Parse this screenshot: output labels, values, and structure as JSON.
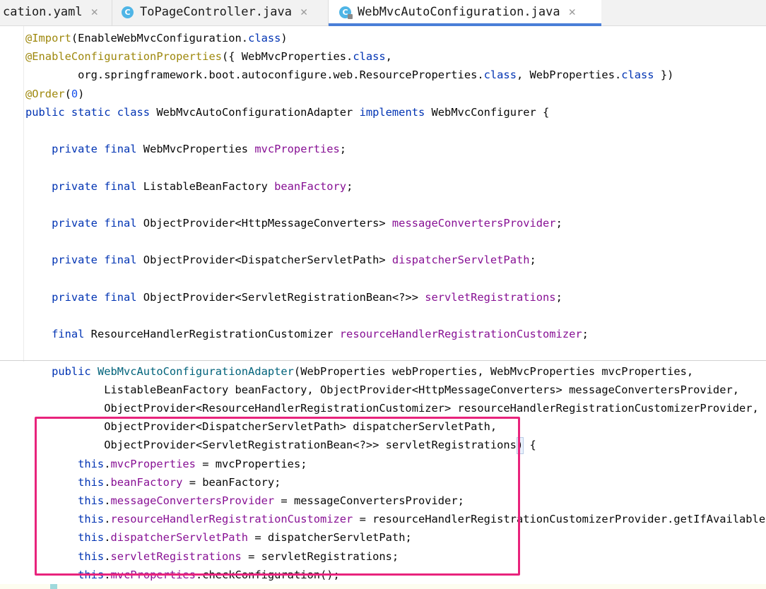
{
  "tabs": [
    {
      "label": "cation.yaml",
      "icon": null,
      "active": false
    },
    {
      "label": "ToPageController.java",
      "icon": "class-c-icon",
      "active": false
    },
    {
      "label": "WebMvcAutoConfiguration.java",
      "icon": "class-c-icon",
      "active": true
    }
  ],
  "tab_close_glyph": "✕",
  "class_icon_letter": "C",
  "colors": {
    "keyword": "#0033b3",
    "annotation": "#9e880d",
    "field": "#871094",
    "number": "#1750eb",
    "constructor": "#00627a",
    "plain": "#080808",
    "highlight_box": "#e8237c",
    "active_tab_underline": "#4a7fd8"
  },
  "code_lines": [
    [
      {
        "t": "@Import",
        "c": "anno"
      },
      {
        "t": "(EnableWebMvcConfiguration.",
        "c": "plain"
      },
      {
        "t": "class",
        "c": "kw"
      },
      {
        "t": ")",
        "c": "plain"
      }
    ],
    [
      {
        "t": "@EnableConfigurationProperties",
        "c": "anno"
      },
      {
        "t": "({ WebMvcProperties.",
        "c": "plain"
      },
      {
        "t": "class",
        "c": "kw"
      },
      {
        "t": ",",
        "c": "plain"
      }
    ],
    [
      {
        "t": "        org.springframework.boot.autoconfigure.web.ResourceProperties.",
        "c": "plain"
      },
      {
        "t": "class",
        "c": "kw"
      },
      {
        "t": ", WebProperties.",
        "c": "plain"
      },
      {
        "t": "class",
        "c": "kw"
      },
      {
        "t": " })",
        "c": "plain"
      }
    ],
    [
      {
        "t": "@Order",
        "c": "anno"
      },
      {
        "t": "(",
        "c": "plain"
      },
      {
        "t": "0",
        "c": "num"
      },
      {
        "t": ")",
        "c": "plain"
      }
    ],
    [
      {
        "t": "public static class ",
        "c": "kw"
      },
      {
        "t": "WebMvcAutoConfigurationAdapter ",
        "c": "plain"
      },
      {
        "t": "implements ",
        "c": "kw"
      },
      {
        "t": "WebMvcConfigurer {",
        "c": "plain"
      }
    ],
    [],
    [
      {
        "t": "    private final ",
        "c": "kw"
      },
      {
        "t": "WebMvcProperties ",
        "c": "plain"
      },
      {
        "t": "mvcProperties",
        "c": "field"
      },
      {
        "t": ";",
        "c": "plain"
      }
    ],
    [],
    [
      {
        "t": "    private final ",
        "c": "kw"
      },
      {
        "t": "ListableBeanFactory ",
        "c": "plain"
      },
      {
        "t": "beanFactory",
        "c": "field"
      },
      {
        "t": ";",
        "c": "plain"
      }
    ],
    [],
    [
      {
        "t": "    private final ",
        "c": "kw"
      },
      {
        "t": "ObjectProvider<HttpMessageConverters> ",
        "c": "plain"
      },
      {
        "t": "messageConvertersProvider",
        "c": "field"
      },
      {
        "t": ";",
        "c": "plain"
      }
    ],
    [],
    [
      {
        "t": "    private final ",
        "c": "kw"
      },
      {
        "t": "ObjectProvider<DispatcherServletPath> ",
        "c": "plain"
      },
      {
        "t": "dispatcherServletPath",
        "c": "field"
      },
      {
        "t": ";",
        "c": "plain"
      }
    ],
    [],
    [
      {
        "t": "    private final ",
        "c": "kw"
      },
      {
        "t": "ObjectProvider<ServletRegistrationBean<?>> ",
        "c": "plain"
      },
      {
        "t": "servletRegistrations",
        "c": "field"
      },
      {
        "t": ";",
        "c": "plain"
      }
    ],
    [],
    [
      {
        "t": "    final ",
        "c": "kw"
      },
      {
        "t": "ResourceHandlerRegistrationCustomizer ",
        "c": "plain"
      },
      {
        "t": "resourceHandlerRegistrationCustomizer",
        "c": "field"
      },
      {
        "t": ";",
        "c": "plain"
      }
    ],
    [],
    [
      {
        "t": "    public ",
        "c": "kw"
      },
      {
        "t": "WebMvcAutoConfigurationAdapter",
        "c": "ctor"
      },
      {
        "t": "(WebProperties webProperties, WebMvcProperties mvcProperties,",
        "c": "plain"
      }
    ],
    [
      {
        "t": "            ListableBeanFactory beanFactory, ObjectProvider<HttpMessageConverters> messageConvertersProvider,",
        "c": "plain"
      }
    ],
    [
      {
        "t": "            ObjectProvider<ResourceHandlerRegistrationCustomizer> resourceHandlerRegistrationCustomizerProvider,",
        "c": "plain"
      }
    ],
    [
      {
        "t": "            ObjectProvider<DispatcherServletPath> dispatcherServletPath,",
        "c": "plain"
      }
    ],
    [
      {
        "t": "            ObjectProvider<ServletRegistrationBean<?>> servletRegistrations) ",
        "c": "plain"
      },
      {
        "t": "{",
        "c": "plain"
      }
    ],
    [
      {
        "t": "        this",
        "c": "kw"
      },
      {
        "t": ".",
        "c": "plain"
      },
      {
        "t": "mvcProperties",
        "c": "field"
      },
      {
        "t": " = mvcProperties;",
        "c": "plain"
      }
    ],
    [
      {
        "t": "        this",
        "c": "kw"
      },
      {
        "t": ".",
        "c": "plain"
      },
      {
        "t": "beanFactory",
        "c": "field"
      },
      {
        "t": " = beanFactory;",
        "c": "plain"
      }
    ],
    [
      {
        "t": "        this",
        "c": "kw"
      },
      {
        "t": ".",
        "c": "plain"
      },
      {
        "t": "messageConvertersProvider",
        "c": "field"
      },
      {
        "t": " = messageConvertersProvider;",
        "c": "plain"
      }
    ],
    [
      {
        "t": "        this",
        "c": "kw"
      },
      {
        "t": ".",
        "c": "plain"
      },
      {
        "t": "resourceHandlerRegistrationCustomizer",
        "c": "field"
      },
      {
        "t": " = resourceHandlerRegistrationCustomizerProvider.getIfAvailable();",
        "c": "plain"
      }
    ],
    [
      {
        "t": "        this",
        "c": "kw"
      },
      {
        "t": ".",
        "c": "plain"
      },
      {
        "t": "dispatcherServletPath",
        "c": "field"
      },
      {
        "t": " = dispatcherServletPath;",
        "c": "plain"
      }
    ],
    [
      {
        "t": "        this",
        "c": "kw"
      },
      {
        "t": ".",
        "c": "plain"
      },
      {
        "t": "servletRegistrations",
        "c": "field"
      },
      {
        "t": " = servletRegistrations;",
        "c": "plain"
      }
    ],
    [
      {
        "t": "        this",
        "c": "kw"
      },
      {
        "t": ".",
        "c": "plain"
      },
      {
        "t": "mvcProperties",
        "c": "field"
      },
      {
        "t": ".checkConfiguration();",
        "c": "plain"
      }
    ]
  ]
}
